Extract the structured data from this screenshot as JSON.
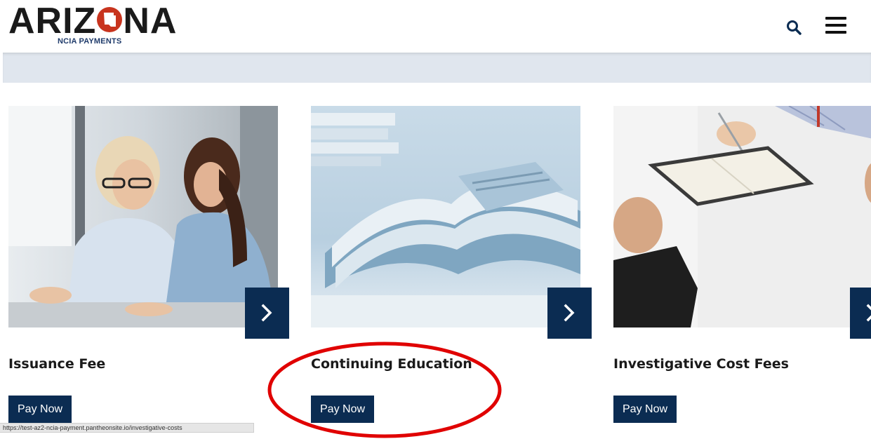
{
  "header": {
    "logo_word_left": "ARIZ",
    "logo_word_right": "NA",
    "logo_subtitle": "NCIA PAYMENTS",
    "search_icon": "search-icon",
    "menu_icon": "hamburger-menu-icon"
  },
  "cards": [
    {
      "title": "Issuance Fee",
      "button_label": "Pay Now",
      "arrow_icon": "chevron-right-icon"
    },
    {
      "title": "Continuing Education",
      "button_label": "Pay Now",
      "arrow_icon": "chevron-right-icon"
    },
    {
      "title": "Investigative Cost Fees",
      "button_label": "Pay Now",
      "arrow_icon": "chevron-right-icon"
    }
  ],
  "status_bar": {
    "url": "https://test-az2-ncia-payment.pantheonsite.io/investigative-costs"
  },
  "colors": {
    "navy": "#0b2c52",
    "logo_red": "#c8341e",
    "banner": "#e0e6ee",
    "annotation_red": "#e00000"
  }
}
